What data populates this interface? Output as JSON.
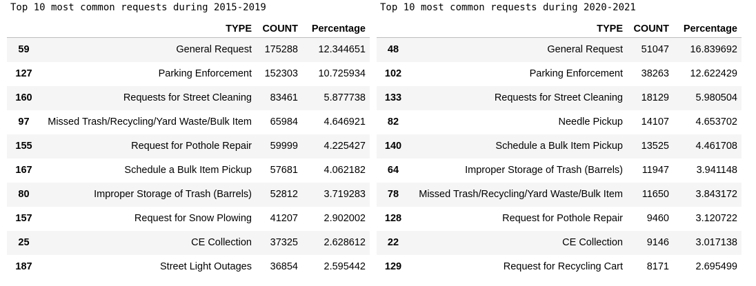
{
  "tables": [
    {
      "caption": "Top 10 most common requests during 2015-2019",
      "columns": [
        "",
        "TYPE",
        "COUNT",
        "Percentage"
      ],
      "rows": [
        {
          "index": "59",
          "type": "General Request",
          "count": "175288",
          "percentage": "12.344651"
        },
        {
          "index": "127",
          "type": "Parking Enforcement",
          "count": "152303",
          "percentage": "10.725934"
        },
        {
          "index": "160",
          "type": "Requests for Street Cleaning",
          "count": "83461",
          "percentage": "5.877738"
        },
        {
          "index": "97",
          "type": "Missed Trash/Recycling/Yard Waste/Bulk Item",
          "count": "65984",
          "percentage": "4.646921"
        },
        {
          "index": "155",
          "type": "Request for Pothole Repair",
          "count": "59999",
          "percentage": "4.225427"
        },
        {
          "index": "167",
          "type": "Schedule a Bulk Item Pickup",
          "count": "57681",
          "percentage": "4.062182"
        },
        {
          "index": "80",
          "type": "Improper Storage of Trash (Barrels)",
          "count": "52812",
          "percentage": "3.719283"
        },
        {
          "index": "157",
          "type": "Request for Snow Plowing",
          "count": "41207",
          "percentage": "2.902002"
        },
        {
          "index": "25",
          "type": "CE Collection",
          "count": "37325",
          "percentage": "2.628612"
        },
        {
          "index": "187",
          "type": "Street Light Outages",
          "count": "36854",
          "percentage": "2.595442"
        }
      ]
    },
    {
      "caption": "Top 10 most common requests during 2020-2021",
      "columns": [
        "",
        "TYPE",
        "COUNT",
        "Percentage"
      ],
      "rows": [
        {
          "index": "48",
          "type": "General Request",
          "count": "51047",
          "percentage": "16.839692"
        },
        {
          "index": "102",
          "type": "Parking Enforcement",
          "count": "38263",
          "percentage": "12.622429"
        },
        {
          "index": "133",
          "type": "Requests for Street Cleaning",
          "count": "18129",
          "percentage": "5.980504"
        },
        {
          "index": "82",
          "type": "Needle Pickup",
          "count": "14107",
          "percentage": "4.653702"
        },
        {
          "index": "140",
          "type": "Schedule a Bulk Item Pickup",
          "count": "13525",
          "percentage": "4.461708"
        },
        {
          "index": "64",
          "type": "Improper Storage of Trash (Barrels)",
          "count": "11947",
          "percentage": "3.941148"
        },
        {
          "index": "78",
          "type": "Missed Trash/Recycling/Yard Waste/Bulk Item",
          "count": "11650",
          "percentage": "3.843172"
        },
        {
          "index": "128",
          "type": "Request for Pothole Repair",
          "count": "9460",
          "percentage": "3.120722"
        },
        {
          "index": "22",
          "type": "CE Collection",
          "count": "9146",
          "percentage": "3.017138"
        },
        {
          "index": "129",
          "type": "Request for Recycling Cart",
          "count": "8171",
          "percentage": "2.695499"
        }
      ]
    }
  ]
}
